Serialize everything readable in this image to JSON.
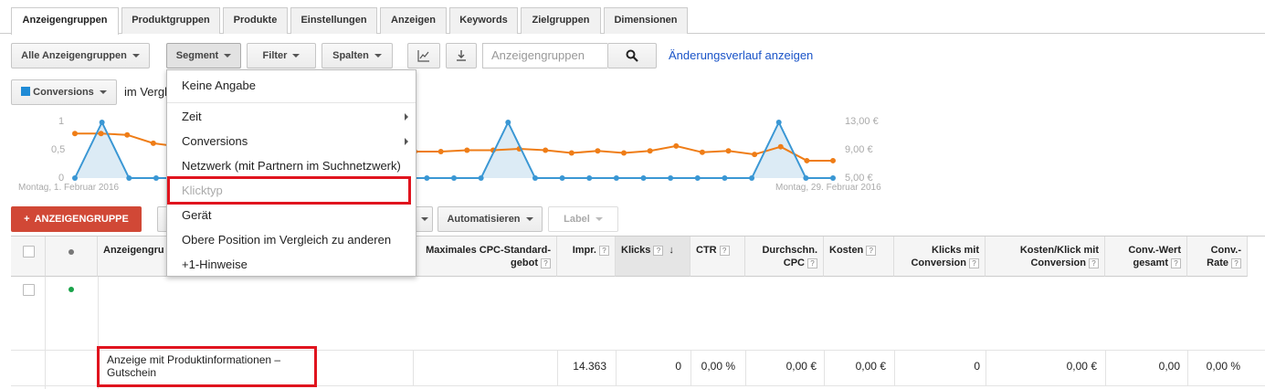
{
  "tabs": [
    "Anzeigengruppen",
    "Produktgruppen",
    "Produkte",
    "Einstellungen",
    "Anzeigen",
    "Keywords",
    "Zielgruppen",
    "Dimensionen"
  ],
  "toolbar": {
    "all_groups": "Alle Anzeigengruppen",
    "segment": "Segment",
    "filter": "Filter",
    "columns": "Spalten",
    "search_placeholder": "Anzeigengruppen",
    "history_link": "Änderungsverlauf anzeigen"
  },
  "metric": {
    "label": "Conversions",
    "compare_text": "im Vergl",
    "color": "#1f8bd6"
  },
  "chart": {
    "left_ticks": [
      "1",
      "0,5",
      "0"
    ],
    "right_ticks": [
      "13,00 €",
      "9,00 €",
      "5,00 €"
    ],
    "start_date": "Montag, 1. Februar 2016",
    "end_date": "Montag, 29. Februar 2016",
    "blue_color": "#3a97d4",
    "orange_color": "#ef7d17"
  },
  "chart_data": {
    "type": "line",
    "x_count": 29,
    "series": [
      {
        "axis": "left",
        "values": [
          0,
          1,
          0,
          0,
          0,
          0,
          0,
          0,
          0,
          0,
          0,
          0,
          0,
          0,
          0,
          0,
          1,
          0,
          0,
          0,
          0,
          0,
          0,
          0,
          0,
          0,
          1,
          0,
          0
        ]
      },
      {
        "axis": "right",
        "values": [
          11.4,
          11.4,
          11.2,
          10.0,
          9.5,
          9.3,
          9.1,
          9.0,
          8.9,
          8.8,
          8.8,
          8.8,
          8.8,
          8.8,
          8.8,
          9.0,
          9.0,
          9.2,
          9.0,
          8.6,
          8.9,
          8.6,
          8.9,
          9.6,
          8.7,
          8.9,
          8.4,
          9.5,
          7.5,
          7.5
        ]
      }
    ],
    "ylim_left": [
      0,
      1
    ],
    "ylim_right": [
      5,
      13
    ]
  },
  "actions": {
    "add_group": "ANZEIGENGRUPPE",
    "automate": "Automatisieren",
    "label": "Label"
  },
  "segment_menu": {
    "items": [
      {
        "label": "Keine Angabe",
        "submenu": false,
        "disabled": false
      },
      {
        "label": "Zeit",
        "submenu": true,
        "disabled": false
      },
      {
        "label": "Conversions",
        "submenu": true,
        "disabled": false
      },
      {
        "label": "Netzwerk (mit Partnern im Suchnetzwerk)",
        "submenu": false,
        "disabled": false
      },
      {
        "label": "Klicktyp",
        "submenu": false,
        "disabled": true
      },
      {
        "label": "Gerät",
        "submenu": false,
        "disabled": false
      },
      {
        "label": "Obere Position im Vergleich zu anderen",
        "submenu": false,
        "disabled": false
      },
      {
        "label": "+1-Hinweise",
        "submenu": false,
        "disabled": false
      }
    ]
  },
  "table": {
    "headers": {
      "group": "Anzeigengru",
      "max_cpc": "Maximales CPC-Standard-gebot",
      "impr": "Impr.",
      "clicks": "Klicks",
      "ctr": "CTR",
      "avg_cpc": "Durchschn. CPC",
      "cost": "Kosten",
      "conv_clicks": "Klicks mit Conversion",
      "cost_per_conv": "Kosten/Klick mit Conversion",
      "conv_value": "Conv.-Wert gesamt",
      "conv_rate": "Conv.-Rate"
    },
    "summary_row": {
      "name": "Anzeige mit Produktinformationen – Gutschein",
      "impr": "14.363",
      "clicks": "0",
      "ctr": "0,00 %",
      "avg_cpc": "0,00 €",
      "cost": "0,00 €",
      "conv_clicks": "0",
      "cost_per_conv": "0,00 €",
      "conv_value": "0,00",
      "conv_rate": "0,00 %"
    },
    "status_color": "#1aa34a"
  }
}
